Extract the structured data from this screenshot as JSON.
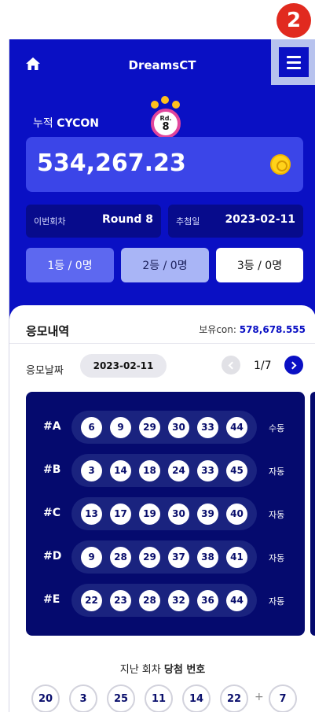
{
  "step_badge": "2",
  "header": {
    "title": "DreamsCT"
  },
  "account": {
    "label_prefix": "누적",
    "label_token": "CYCON",
    "balance": "534,267.23"
  },
  "round_badge": {
    "prefix": "Rd.",
    "number": "8"
  },
  "info": {
    "round_key": "이번회차",
    "round_value": "Round 8",
    "draw_key": "추첨일",
    "draw_value": "2023-02-11"
  },
  "prizes": [
    {
      "label": "1등 / 0명"
    },
    {
      "label": "2등 / 0명"
    },
    {
      "label": "3등 / 0명"
    }
  ],
  "entries": {
    "title": "응모내역",
    "holding_label": "보유con:",
    "holding_value": "578,678.555",
    "date_label": "응모날짜",
    "date_value": "2023-02-11",
    "page": "1/7",
    "tickets": [
      {
        "code": "#A",
        "numbers": [
          "6",
          "9",
          "29",
          "30",
          "33",
          "44"
        ],
        "mode": "수동"
      },
      {
        "code": "#B",
        "numbers": [
          "3",
          "14",
          "18",
          "24",
          "33",
          "45"
        ],
        "mode": "자동"
      },
      {
        "code": "#C",
        "numbers": [
          "13",
          "17",
          "19",
          "30",
          "39",
          "40"
        ],
        "mode": "자동"
      },
      {
        "code": "#D",
        "numbers": [
          "9",
          "28",
          "29",
          "37",
          "38",
          "41"
        ],
        "mode": "자동"
      },
      {
        "code": "#E",
        "numbers": [
          "22",
          "23",
          "28",
          "32",
          "36",
          "44"
        ],
        "mode": "자동"
      }
    ]
  },
  "past": {
    "title_prefix": "지난 회차",
    "title_bold": "당첨 번호",
    "numbers": [
      "20",
      "3",
      "25",
      "11",
      "14",
      "22"
    ],
    "plus": "+",
    "bonus": "7"
  },
  "colors": {
    "brand_blue": "#0a10c4",
    "ticket_bg": "#050a6e",
    "step_badge": "#e12a1f",
    "coin": "#ffd21a"
  }
}
